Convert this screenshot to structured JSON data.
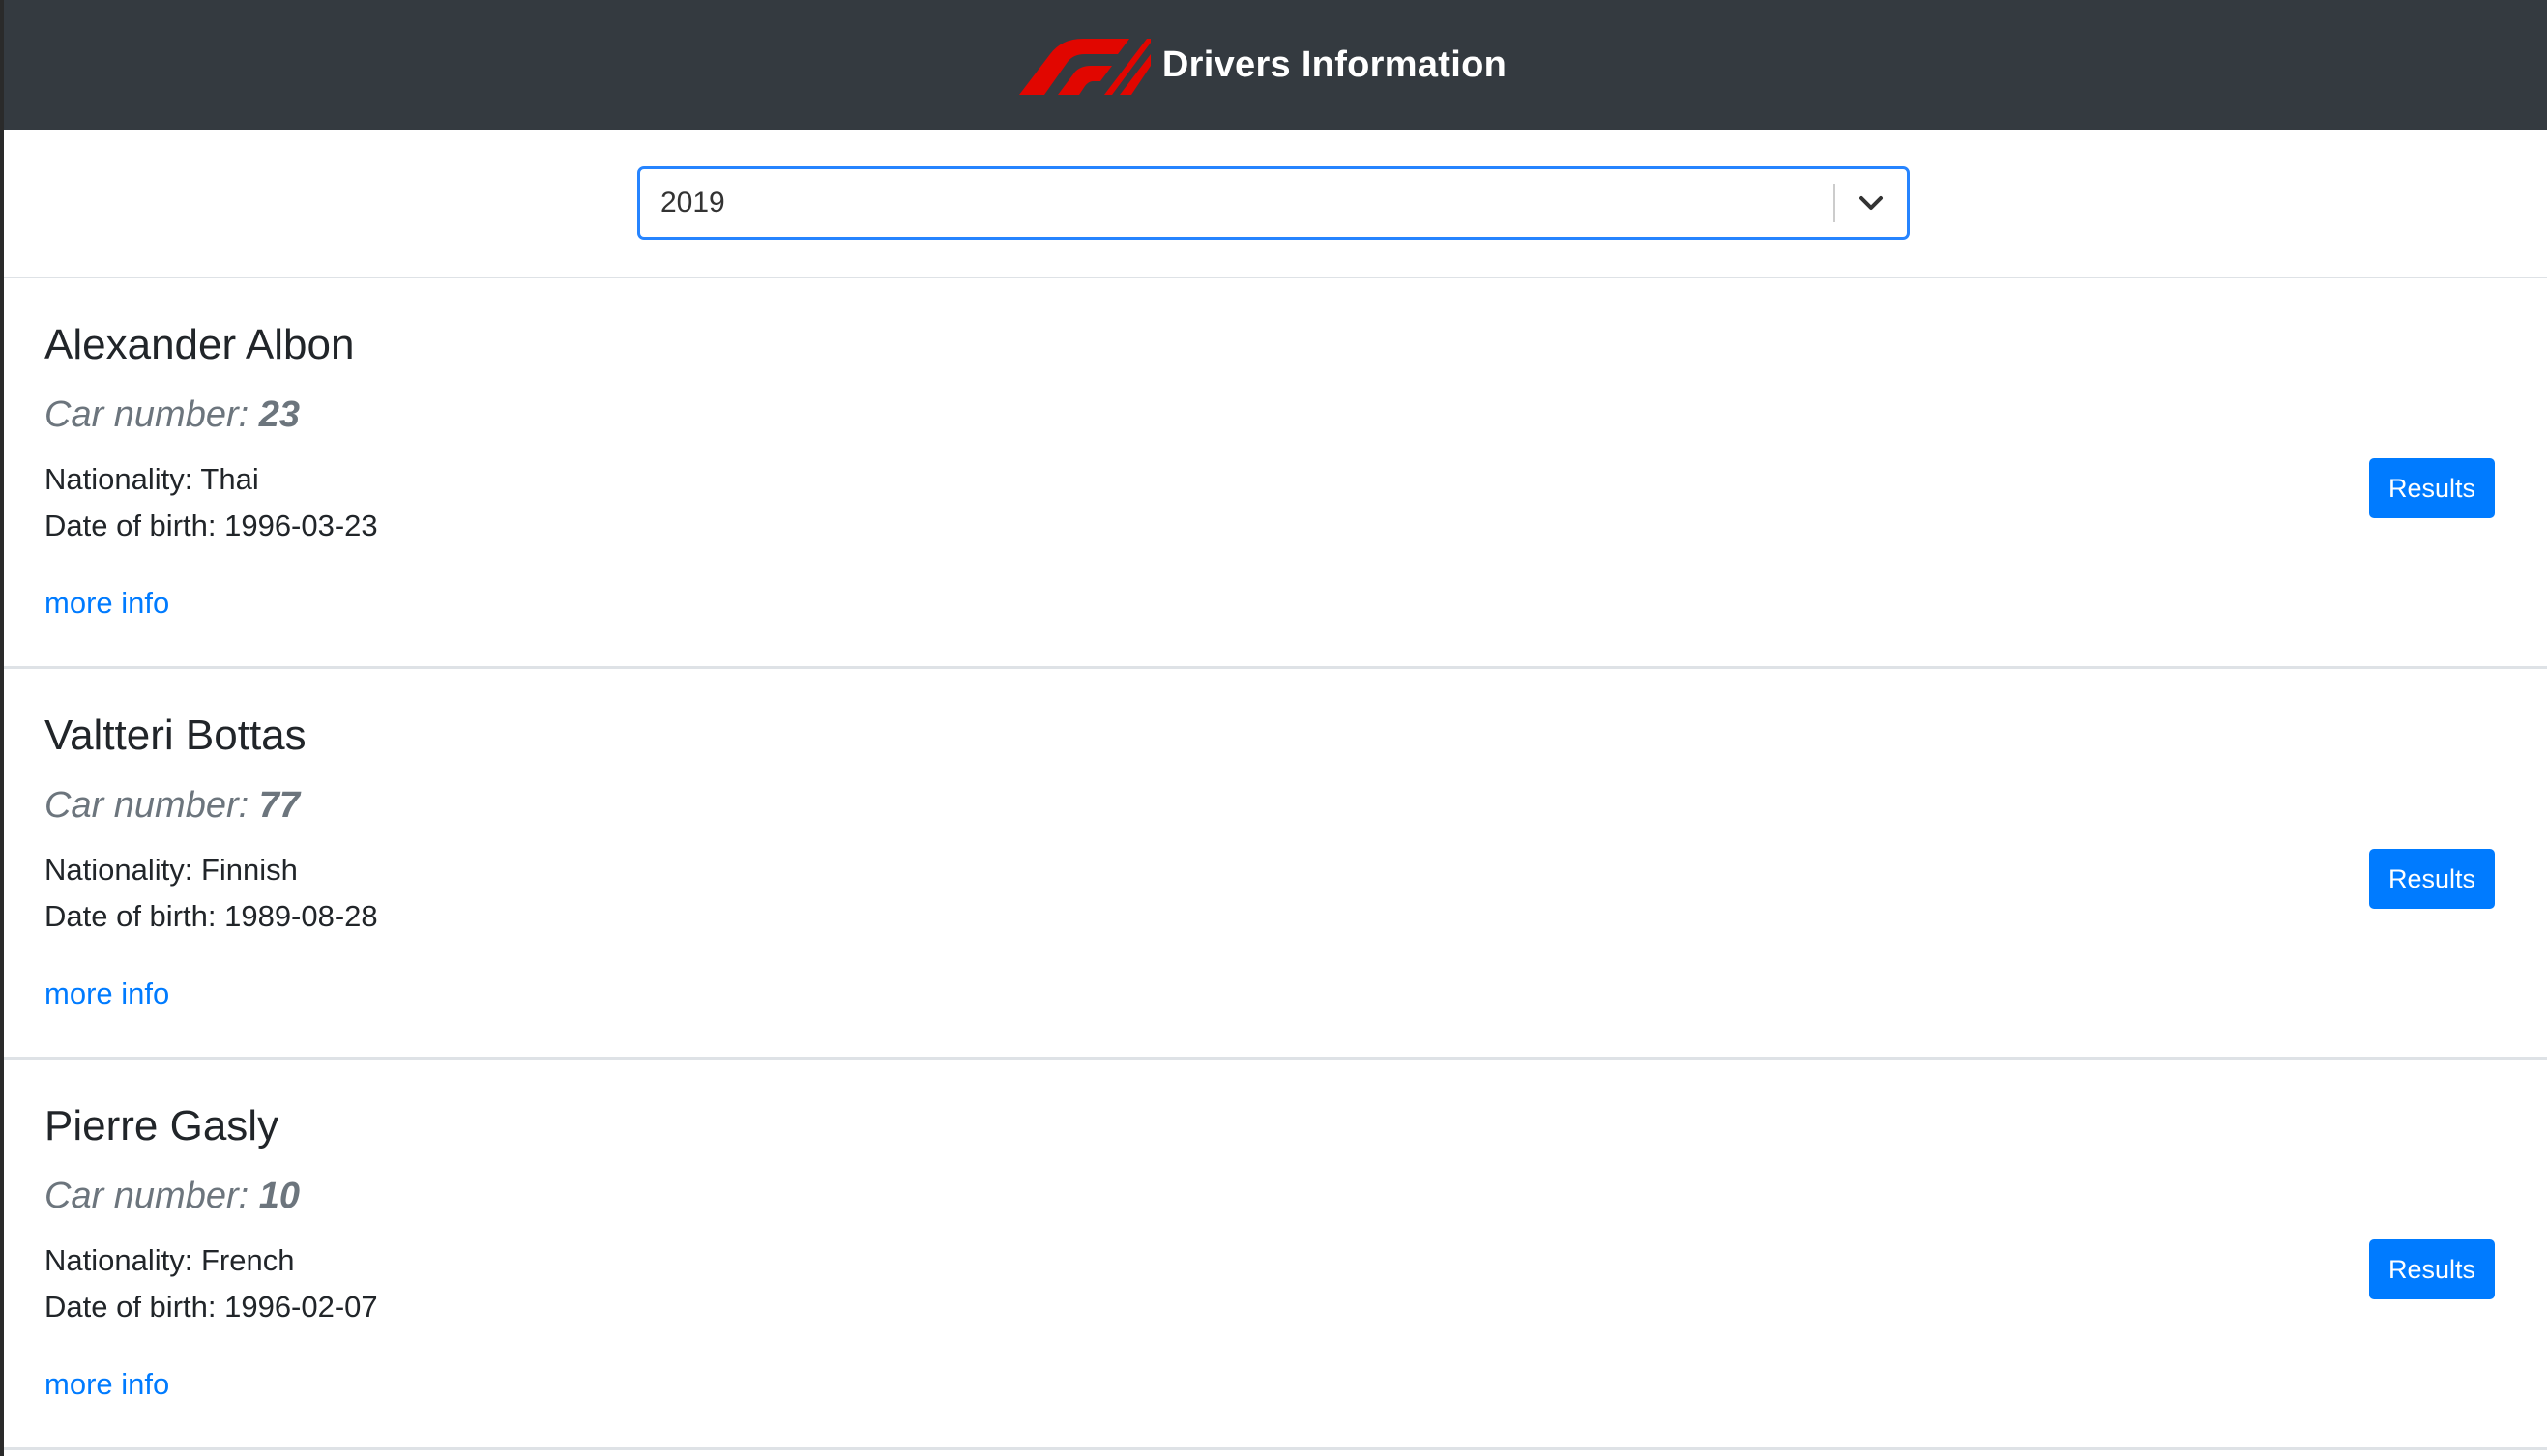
{
  "header": {
    "title": "Drivers Information",
    "logo_icon": "f1-logo-icon",
    "background": "#343a40",
    "logo_color": "#e10600"
  },
  "season_select": {
    "value": "2019",
    "icon": "chevron-down-icon",
    "border_color": "#2684ff"
  },
  "drivers": [
    {
      "name": "Alexander Albon",
      "car_label": "Car number:",
      "car_number": "23",
      "nationality": "Nationality: Thai",
      "dob": "Date of birth: 1996-03-23",
      "more_info": "more info",
      "results_label": "Results"
    },
    {
      "name": "Valtteri Bottas",
      "car_label": "Car number:",
      "car_number": "77",
      "nationality": "Nationality: Finnish",
      "dob": "Date of birth: 1989-08-28",
      "more_info": "more info",
      "results_label": "Results"
    },
    {
      "name": "Pierre Gasly",
      "car_label": "Car number:",
      "car_number": "10",
      "nationality": "Nationality: French",
      "dob": "Date of birth: 1996-02-07",
      "more_info": "more info",
      "results_label": "Results"
    }
  ],
  "colors": {
    "primary": "#007bff",
    "muted": "#6c757d",
    "text": "#212529"
  }
}
